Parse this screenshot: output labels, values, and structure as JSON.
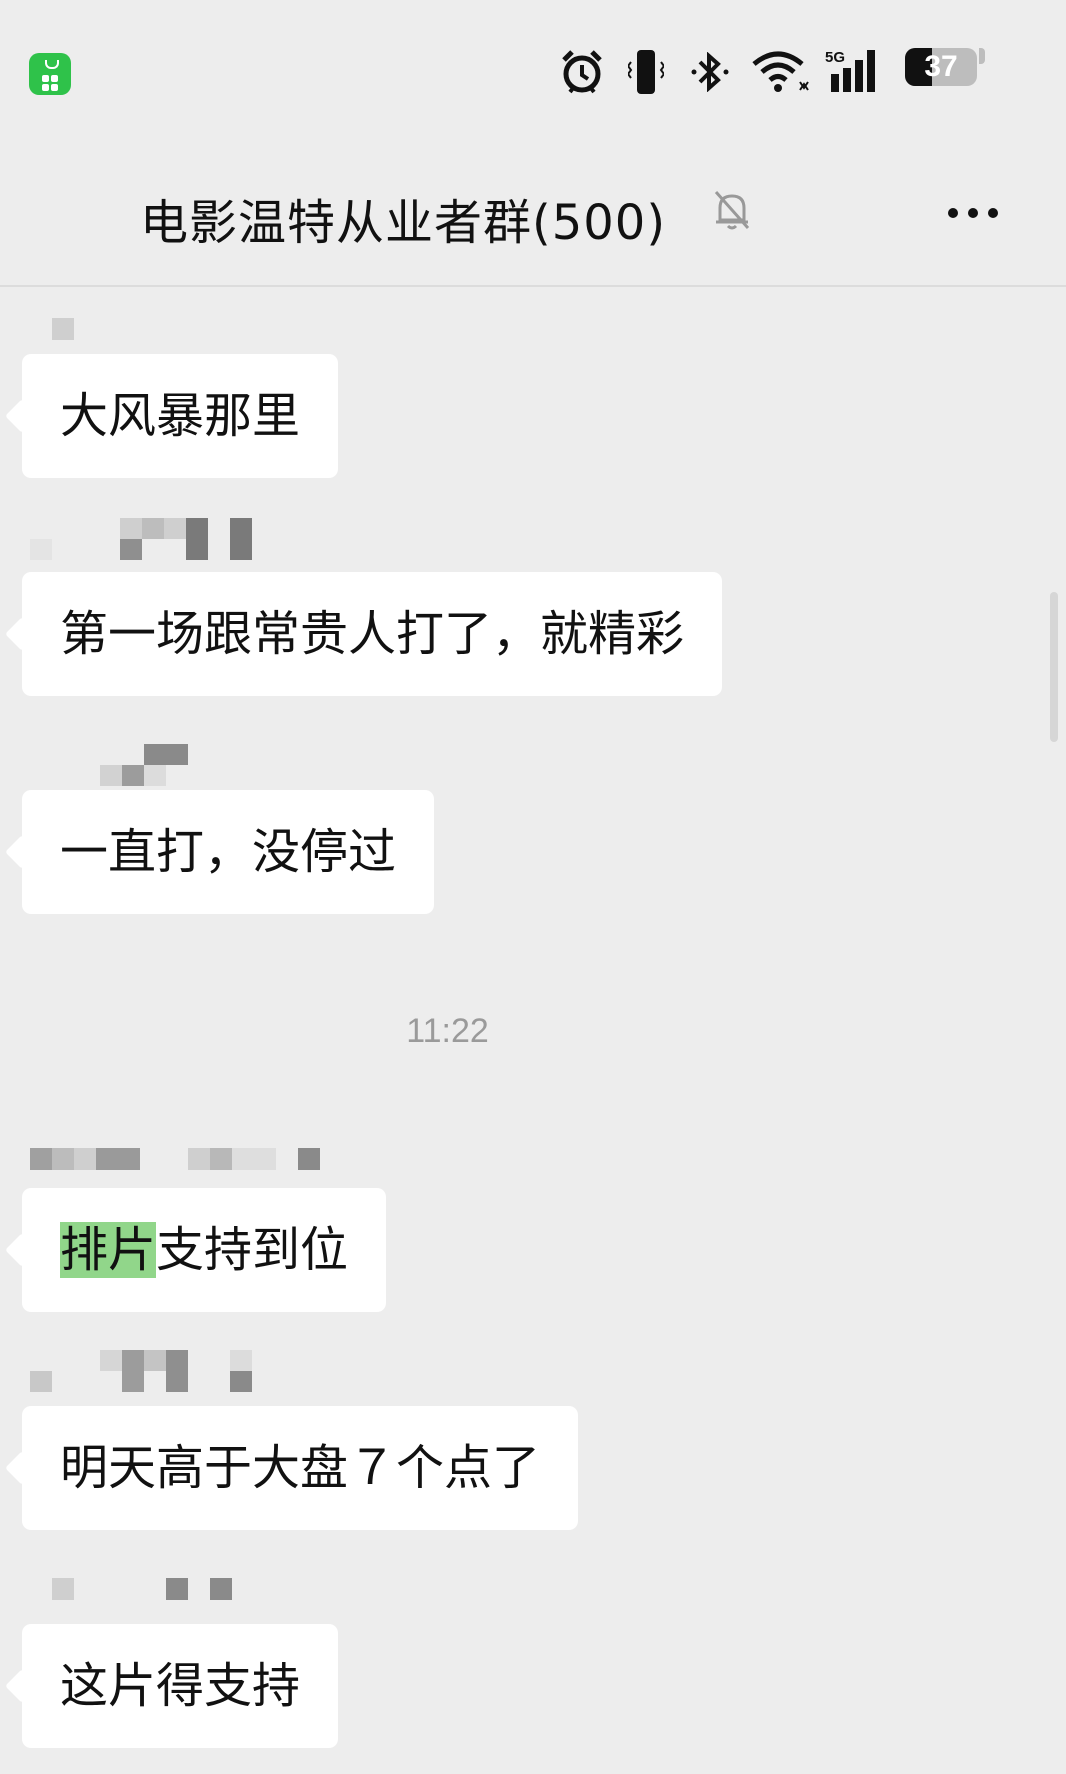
{
  "status_bar": {
    "battery_level": "37",
    "network": "5G",
    "icons": [
      "alarm-icon",
      "vibrate-icon",
      "bluetooth-icon",
      "wifi-icon",
      "signal-5g-icon",
      "battery-icon"
    ]
  },
  "header": {
    "title": "电影温特从业者群(500)",
    "mute_icon": "bell-off-icon",
    "more_icon": "more-dots-icon"
  },
  "messages": [
    {
      "text": "大风暴那里"
    },
    {
      "text": "第一场跟常贵人打了，就精彩"
    },
    {
      "text": "一直打，没停过"
    },
    {
      "timestamp": "11:22"
    },
    {
      "text_highlight": "排片",
      "text_rest": "支持到位"
    },
    {
      "text": "明天高于大盘７个点了"
    },
    {
      "text": "这片得支持"
    }
  ],
  "colors": {
    "background": "#ededed",
    "bubble": "#ffffff",
    "highlight": "#91d68a",
    "app_icon": "#2fc24a"
  }
}
